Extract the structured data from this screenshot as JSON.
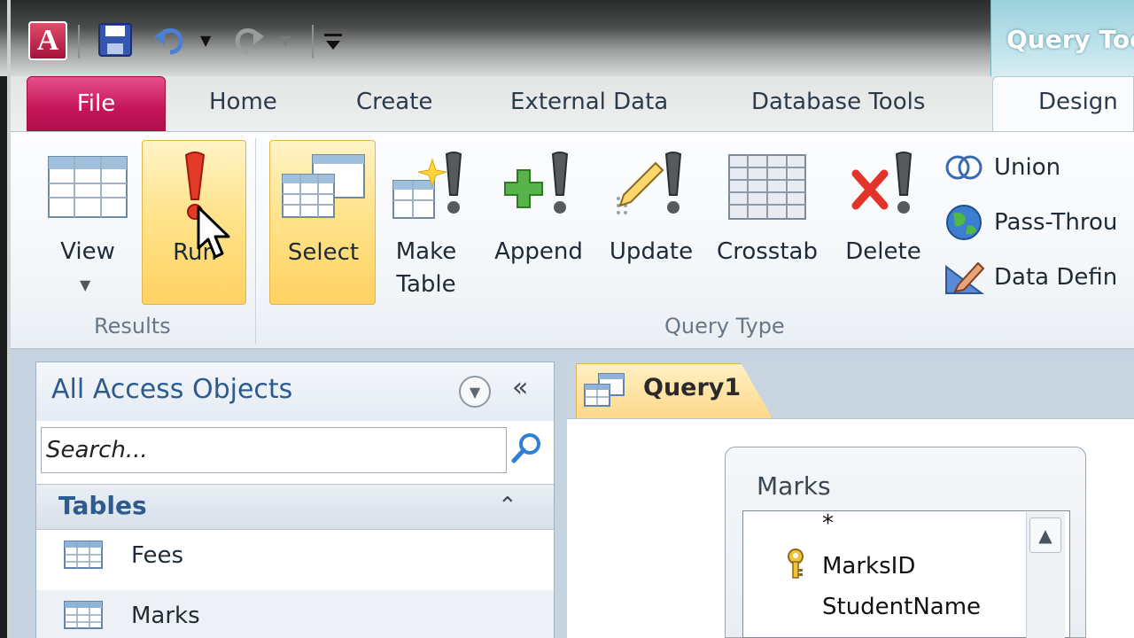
{
  "app": {
    "logo_letter": "A",
    "contextual_tab_title": "Query Too"
  },
  "ribbon_tabs": {
    "file": "File",
    "home": "Home",
    "create": "Create",
    "external_data": "External Data",
    "database_tools": "Database Tools",
    "design": "Design"
  },
  "groups": {
    "results": {
      "label": "Results",
      "view_label": "View",
      "run_label": "Run"
    },
    "query_type": {
      "label": "Query Type",
      "select_label": "Select",
      "make_table_label_1": "Make",
      "make_table_label_2": "Table",
      "append_label": "Append",
      "update_label": "Update",
      "crosstab_label": "Crosstab",
      "delete_label": "Delete",
      "union_label": "Union",
      "pass_through_label": "Pass-Throu",
      "data_definition_label": "Data Defin"
    }
  },
  "nav_pane": {
    "title": "All Access Objects",
    "collapse_glyph": "«",
    "search_placeholder": "Search...",
    "tables_header": "Tables",
    "items": [
      {
        "label": "Fees"
      },
      {
        "label": "Marks"
      }
    ]
  },
  "document": {
    "tab_label": "Query1",
    "field_list": {
      "title": "Marks",
      "fields": [
        "*",
        "MarksID",
        "StudentName"
      ]
    }
  },
  "colors": {
    "file_tab": "#c6155a",
    "hot_button": "#ffd262",
    "accent_blue": "#2d5a8f",
    "contextual_tab": "#9bd1dd"
  },
  "icons": {
    "save": "save-icon",
    "undo": "undo-icon",
    "redo": "redo-icon",
    "search": "search-icon",
    "primary_key": "key-icon"
  }
}
